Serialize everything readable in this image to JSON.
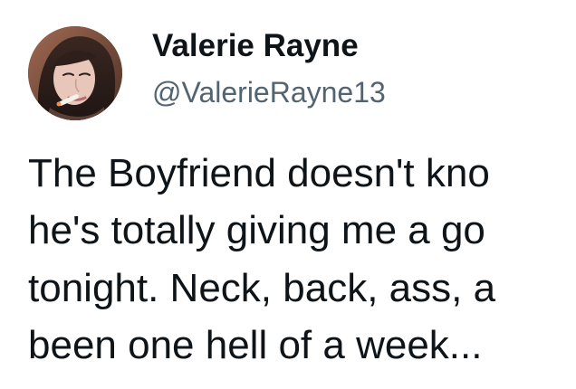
{
  "tweet": {
    "author": {
      "display_name": "Valerie Rayne",
      "handle": "@ValerieRayne13",
      "avatar_icon": "profile-photo-avatar"
    },
    "body_lines": [
      "The Boyfriend doesn't kno",
      "he's totally giving me a go",
      "tonight. Neck, back, ass, a",
      "been one hell of a week..."
    ]
  },
  "colors": {
    "background": "#ffffff",
    "primary_text": "#0f1419",
    "secondary_text": "#536471"
  }
}
